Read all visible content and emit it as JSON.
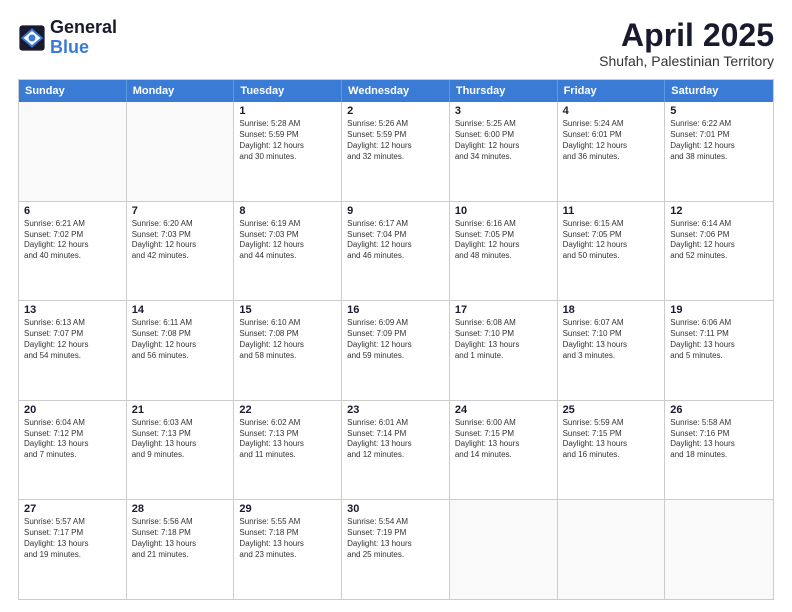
{
  "logo": {
    "line1": "General",
    "line2": "Blue"
  },
  "title": "April 2025",
  "subtitle": "Shufah, Palestinian Territory",
  "header_days": [
    "Sunday",
    "Monday",
    "Tuesday",
    "Wednesday",
    "Thursday",
    "Friday",
    "Saturday"
  ],
  "weeks": [
    [
      {
        "day": "",
        "text": ""
      },
      {
        "day": "",
        "text": ""
      },
      {
        "day": "1",
        "text": "Sunrise: 5:28 AM\nSunset: 5:59 PM\nDaylight: 12 hours\nand 30 minutes."
      },
      {
        "day": "2",
        "text": "Sunrise: 5:26 AM\nSunset: 5:59 PM\nDaylight: 12 hours\nand 32 minutes."
      },
      {
        "day": "3",
        "text": "Sunrise: 5:25 AM\nSunset: 6:00 PM\nDaylight: 12 hours\nand 34 minutes."
      },
      {
        "day": "4",
        "text": "Sunrise: 5:24 AM\nSunset: 6:01 PM\nDaylight: 12 hours\nand 36 minutes."
      },
      {
        "day": "5",
        "text": "Sunrise: 6:22 AM\nSunset: 7:01 PM\nDaylight: 12 hours\nand 38 minutes."
      }
    ],
    [
      {
        "day": "6",
        "text": "Sunrise: 6:21 AM\nSunset: 7:02 PM\nDaylight: 12 hours\nand 40 minutes."
      },
      {
        "day": "7",
        "text": "Sunrise: 6:20 AM\nSunset: 7:03 PM\nDaylight: 12 hours\nand 42 minutes."
      },
      {
        "day": "8",
        "text": "Sunrise: 6:19 AM\nSunset: 7:03 PM\nDaylight: 12 hours\nand 44 minutes."
      },
      {
        "day": "9",
        "text": "Sunrise: 6:17 AM\nSunset: 7:04 PM\nDaylight: 12 hours\nand 46 minutes."
      },
      {
        "day": "10",
        "text": "Sunrise: 6:16 AM\nSunset: 7:05 PM\nDaylight: 12 hours\nand 48 minutes."
      },
      {
        "day": "11",
        "text": "Sunrise: 6:15 AM\nSunset: 7:05 PM\nDaylight: 12 hours\nand 50 minutes."
      },
      {
        "day": "12",
        "text": "Sunrise: 6:14 AM\nSunset: 7:06 PM\nDaylight: 12 hours\nand 52 minutes."
      }
    ],
    [
      {
        "day": "13",
        "text": "Sunrise: 6:13 AM\nSunset: 7:07 PM\nDaylight: 12 hours\nand 54 minutes."
      },
      {
        "day": "14",
        "text": "Sunrise: 6:11 AM\nSunset: 7:08 PM\nDaylight: 12 hours\nand 56 minutes."
      },
      {
        "day": "15",
        "text": "Sunrise: 6:10 AM\nSunset: 7:08 PM\nDaylight: 12 hours\nand 58 minutes."
      },
      {
        "day": "16",
        "text": "Sunrise: 6:09 AM\nSunset: 7:09 PM\nDaylight: 12 hours\nand 59 minutes."
      },
      {
        "day": "17",
        "text": "Sunrise: 6:08 AM\nSunset: 7:10 PM\nDaylight: 13 hours\nand 1 minute."
      },
      {
        "day": "18",
        "text": "Sunrise: 6:07 AM\nSunset: 7:10 PM\nDaylight: 13 hours\nand 3 minutes."
      },
      {
        "day": "19",
        "text": "Sunrise: 6:06 AM\nSunset: 7:11 PM\nDaylight: 13 hours\nand 5 minutes."
      }
    ],
    [
      {
        "day": "20",
        "text": "Sunrise: 6:04 AM\nSunset: 7:12 PM\nDaylight: 13 hours\nand 7 minutes."
      },
      {
        "day": "21",
        "text": "Sunrise: 6:03 AM\nSunset: 7:13 PM\nDaylight: 13 hours\nand 9 minutes."
      },
      {
        "day": "22",
        "text": "Sunrise: 6:02 AM\nSunset: 7:13 PM\nDaylight: 13 hours\nand 11 minutes."
      },
      {
        "day": "23",
        "text": "Sunrise: 6:01 AM\nSunset: 7:14 PM\nDaylight: 13 hours\nand 12 minutes."
      },
      {
        "day": "24",
        "text": "Sunrise: 6:00 AM\nSunset: 7:15 PM\nDaylight: 13 hours\nand 14 minutes."
      },
      {
        "day": "25",
        "text": "Sunrise: 5:59 AM\nSunset: 7:15 PM\nDaylight: 13 hours\nand 16 minutes."
      },
      {
        "day": "26",
        "text": "Sunrise: 5:58 AM\nSunset: 7:16 PM\nDaylight: 13 hours\nand 18 minutes."
      }
    ],
    [
      {
        "day": "27",
        "text": "Sunrise: 5:57 AM\nSunset: 7:17 PM\nDaylight: 13 hours\nand 19 minutes."
      },
      {
        "day": "28",
        "text": "Sunrise: 5:56 AM\nSunset: 7:18 PM\nDaylight: 13 hours\nand 21 minutes."
      },
      {
        "day": "29",
        "text": "Sunrise: 5:55 AM\nSunset: 7:18 PM\nDaylight: 13 hours\nand 23 minutes."
      },
      {
        "day": "30",
        "text": "Sunrise: 5:54 AM\nSunset: 7:19 PM\nDaylight: 13 hours\nand 25 minutes."
      },
      {
        "day": "",
        "text": ""
      },
      {
        "day": "",
        "text": ""
      },
      {
        "day": "",
        "text": ""
      }
    ]
  ]
}
